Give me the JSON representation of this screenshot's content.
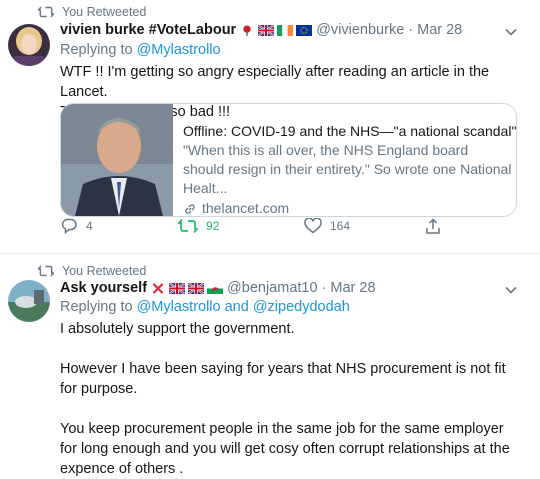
{
  "tweets": [
    {
      "retweet_label": "You Retweeted",
      "name": "vivien burke #VoteLabour",
      "name_flags": [
        "rose",
        "uk-flag",
        "ireland-flag",
        "eu-flag"
      ],
      "handle": "@vivienburke",
      "separator": "·",
      "date": "Mar 28",
      "replying_prefix": "Replying to",
      "replying_to": "@Mylastrollo",
      "text_lines": [
        "WTF !! I'm getting so angry especially after reading an article in the Lancet.",
        "This is gonna be so bad !!!"
      ],
      "card": {
        "title": "Offline: COVID-19 and the NHS—\"a national scandal\"",
        "description": "\"When this is all over, the NHS England board should resign in their entirety.\" So wrote one National Healt...",
        "url": "thelancet.com"
      },
      "actions": {
        "replies": "4",
        "retweets": "92",
        "likes": "164"
      }
    },
    {
      "retweet_label": "You Retweeted",
      "name": "Ask yourself",
      "name_flags": [
        "red-x",
        "uk-flag",
        "uk-flag",
        "wales-flag"
      ],
      "handle": "@benjamat10",
      "separator": "·",
      "date": "Mar 28",
      "replying_prefix": "Replying to",
      "replying_to": "@Mylastrollo and @zipedydodah",
      "paragraphs": [
        "I absolutely support the government.",
        "However I have been saying for years that NHS procurement is not fit for purpose.",
        "You keep procurement people in the same job for the same employer for long enough and you will get cosy often corrupt relationships at the expence of others ."
      ]
    }
  ],
  "colors": {
    "accent": "#1b95e0",
    "muted": "#657786",
    "retweet_green": "#17bf63"
  }
}
